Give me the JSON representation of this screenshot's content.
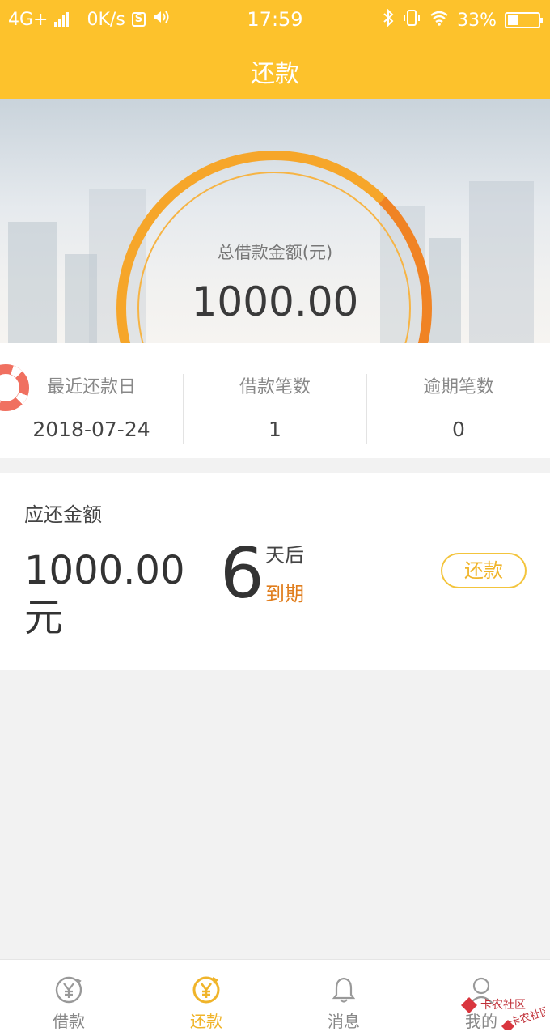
{
  "status_bar": {
    "network": "4G+",
    "speed": "0K/s",
    "app_badge": "S",
    "time": "17:59",
    "battery_percent": "33%",
    "battery_level": 0.33
  },
  "header": {
    "title": "还款"
  },
  "summary": {
    "caption": "总借款金额(元)",
    "amount": "1000.00"
  },
  "stats": [
    {
      "label": "最近还款日",
      "value": "2018-07-24"
    },
    {
      "label": "借款笔数",
      "value": "1"
    },
    {
      "label": "逾期笔数",
      "value": "0"
    }
  ],
  "due": {
    "label": "应还金额",
    "amount": "1000.00元",
    "days": "6",
    "days_suffix": "天后",
    "due_word": "到期",
    "button": "还款"
  },
  "tabs": [
    {
      "label": "借款",
      "icon": "yen-circle-icon",
      "active": false
    },
    {
      "label": "还款",
      "icon": "yen-refresh-icon",
      "active": true
    },
    {
      "label": "消息",
      "icon": "bell-icon",
      "active": false
    },
    {
      "label": "我的",
      "icon": "user-icon",
      "active": false
    }
  ],
  "watermark": {
    "text": "卡农社区"
  },
  "colors": {
    "brand": "#fdc22c",
    "accent_orange": "#f08324",
    "due_orange": "#e07d1c"
  }
}
